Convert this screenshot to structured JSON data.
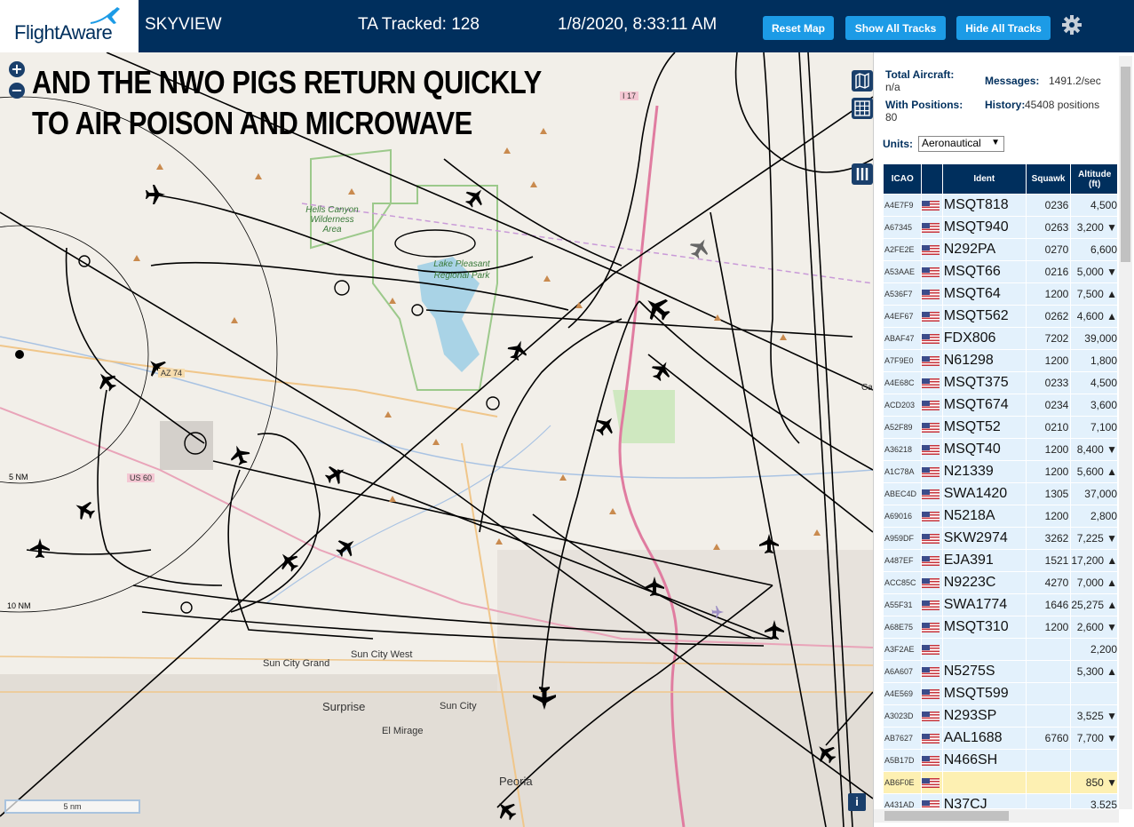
{
  "header": {
    "logo_text": "FlightAware",
    "app_title": "SKYVIEW",
    "tracked": "TA Tracked: 128",
    "datetime": "1/8/2020, 8:33:11 AM",
    "reset_label": "Reset Map",
    "show_label": "Show All Tracks",
    "hide_label": "Hide All Tracks",
    "settings_icon": "gear-icon"
  },
  "map": {
    "caption_line1": "AND THE NWO PIGS RETURN QUICKLY",
    "caption_line2": "TO AIR POISON AND MICROWAVE",
    "zoom_in": "+",
    "zoom_out": "−",
    "scale_label": "5 nm",
    "ring_labels": [
      "5 NM",
      "10 NM"
    ],
    "places": {
      "hells_canyon": "Hells Canyon Wilderness Area",
      "lake_pleasant": "Lake Pleasant Regional Park",
      "sun_city_grand": "Sun City Grand",
      "sun_city_west": "Sun City West",
      "surprise": "Surprise",
      "sun_city": "Sun City",
      "el_mirage": "El Mirage",
      "peoria": "Peoria",
      "i17": "I 17",
      "az74": "AZ 74",
      "us60": "US 60",
      "ca": "Ca"
    },
    "info_label": "i"
  },
  "stats": {
    "total_label": "Total Aircraft:",
    "total_value": "n/a",
    "positions_label": "With Positions:",
    "positions_value": "80",
    "messages_label": "Messages:",
    "messages_value": "1491.2/sec",
    "history_label": "History:",
    "history_value": "45408 positions",
    "units_label": "Units:",
    "units_value": "Aeronautical"
  },
  "table": {
    "headers": [
      "ICAO",
      "",
      "Ident",
      "Squawk",
      "Altitude (ft)"
    ],
    "rows": [
      {
        "icao": "A4E7F9",
        "ident": "MSQT818",
        "squawk": "0236",
        "alt": "4,500"
      },
      {
        "icao": "A67345",
        "ident": "MSQT940",
        "squawk": "0263",
        "alt": "3,200 ▼"
      },
      {
        "icao": "A2FE2E",
        "ident": "N292PA",
        "squawk": "0270",
        "alt": "6,600"
      },
      {
        "icao": "A53AAE",
        "ident": "MSQT66",
        "squawk": "0216",
        "alt": "5,000 ▼"
      },
      {
        "icao": "A536F7",
        "ident": "MSQT64",
        "squawk": "1200",
        "alt": "7,500 ▲"
      },
      {
        "icao": "A4EF67",
        "ident": "MSQT562",
        "squawk": "0262",
        "alt": "4,600 ▲"
      },
      {
        "icao": "ABAF47",
        "ident": "FDX806",
        "squawk": "7202",
        "alt": "39,000"
      },
      {
        "icao": "A7F9E0",
        "ident": "N61298",
        "squawk": "1200",
        "alt": "1,800"
      },
      {
        "icao": "A4E68C",
        "ident": "MSQT375",
        "squawk": "0233",
        "alt": "4,500"
      },
      {
        "icao": "ACD203",
        "ident": "MSQT674",
        "squawk": "0234",
        "alt": "3,600"
      },
      {
        "icao": "A52F89",
        "ident": "MSQT52",
        "squawk": "0210",
        "alt": "7,100"
      },
      {
        "icao": "A36218",
        "ident": "MSQT40",
        "squawk": "1200",
        "alt": "8,400 ▼"
      },
      {
        "icao": "A1C78A",
        "ident": "N21339",
        "squawk": "1200",
        "alt": "5,600 ▲"
      },
      {
        "icao": "ABEC4D",
        "ident": "SWA1420",
        "squawk": "1305",
        "alt": "37,000"
      },
      {
        "icao": "A69016",
        "ident": "N5218A",
        "squawk": "1200",
        "alt": "2,800"
      },
      {
        "icao": "A959DF",
        "ident": "SKW2974",
        "squawk": "3262",
        "alt": "7,225 ▼"
      },
      {
        "icao": "A487EF",
        "ident": "EJA391",
        "squawk": "1521",
        "alt": "17,200 ▲"
      },
      {
        "icao": "ACC85C",
        "ident": "N9223C",
        "squawk": "4270",
        "alt": "7,000 ▲"
      },
      {
        "icao": "A55F31",
        "ident": "SWA1774",
        "squawk": "1646",
        "alt": "25,275 ▲"
      },
      {
        "icao": "A68E75",
        "ident": "MSQT310",
        "squawk": "1200",
        "alt": "2,600 ▼"
      },
      {
        "icao": "A3F2AE",
        "ident": "",
        "squawk": "",
        "alt": "2,200"
      },
      {
        "icao": "A6A607",
        "ident": "N5275S",
        "squawk": "",
        "alt": "5,300 ▲"
      },
      {
        "icao": "A4E569",
        "ident": "MSQT599",
        "squawk": "",
        "alt": ""
      },
      {
        "icao": "A3023D",
        "ident": "N293SP",
        "squawk": "",
        "alt": "3,525 ▼"
      },
      {
        "icao": "AB7627",
        "ident": "AAL1688",
        "squawk": "6760",
        "alt": "7,700 ▼"
      },
      {
        "icao": "A5B17D",
        "ident": "N466SH",
        "squawk": "",
        "alt": ""
      },
      {
        "icao": "AB6F0E",
        "ident": "",
        "squawk": "",
        "alt": "850 ▼",
        "selected": true
      },
      {
        "icao": "A431AD",
        "ident": "N37CJ",
        "squawk": "",
        "alt": "3,525"
      }
    ]
  },
  "colors": {
    "header_bg": "#002f5d",
    "button_bg": "#1c9be6",
    "row_bg": "#e3f1fc",
    "selected_row_bg": "#fdf0b2"
  }
}
